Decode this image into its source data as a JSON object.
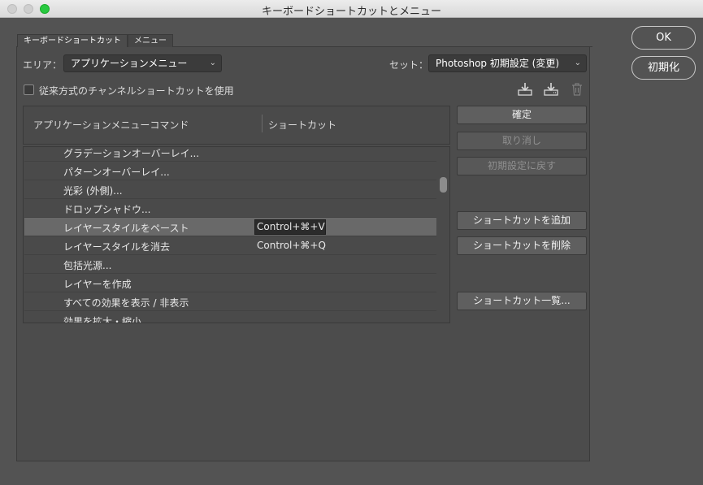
{
  "window": {
    "title": "キーボードショートカットとメニュー"
  },
  "tabs": [
    "キーボードショートカット",
    "メニュー"
  ],
  "area": {
    "label": "エリア：",
    "value": "アプリケーションメニュー"
  },
  "set": {
    "label": "セット：",
    "value": "Photoshop 初期設定 (変更)"
  },
  "checkbox_label": "従来方式のチャンネルショートカットを使用",
  "table": {
    "col_command": "アプリケーションメニューコマンド",
    "col_shortcut": "ショートカット",
    "rows": [
      {
        "command": "グラデーションオーバーレイ...",
        "shortcut": ""
      },
      {
        "command": "パターンオーバーレイ...",
        "shortcut": ""
      },
      {
        "command": "光彩 (外側)...",
        "shortcut": ""
      },
      {
        "command": "ドロップシャドウ...",
        "shortcut": ""
      },
      {
        "command": "レイヤースタイルをペースト",
        "shortcut": "Control+⌘+V"
      },
      {
        "command": "レイヤースタイルを消去",
        "shortcut": "Control+⌘+Q"
      },
      {
        "command": "包括光源...",
        "shortcut": ""
      },
      {
        "command": "レイヤーを作成",
        "shortcut": ""
      },
      {
        "command": "すべての効果を表示 / 非表示",
        "shortcut": ""
      },
      {
        "command": "効果を拡大・縮小...",
        "shortcut": ""
      }
    ]
  },
  "buttons": {
    "accept": "確定",
    "undo": "取り消し",
    "use_default": "初期設定に戻す",
    "add_shortcut": "ショートカットを追加",
    "delete_shortcut": "ショートカットを削除",
    "summarize": "ショートカット一覧...",
    "ok": "OK",
    "reset": "初期化"
  },
  "icons": {
    "save_set": "save-set-icon",
    "save_set_as": "save-set-as-icon",
    "delete_set": "trash-icon"
  }
}
